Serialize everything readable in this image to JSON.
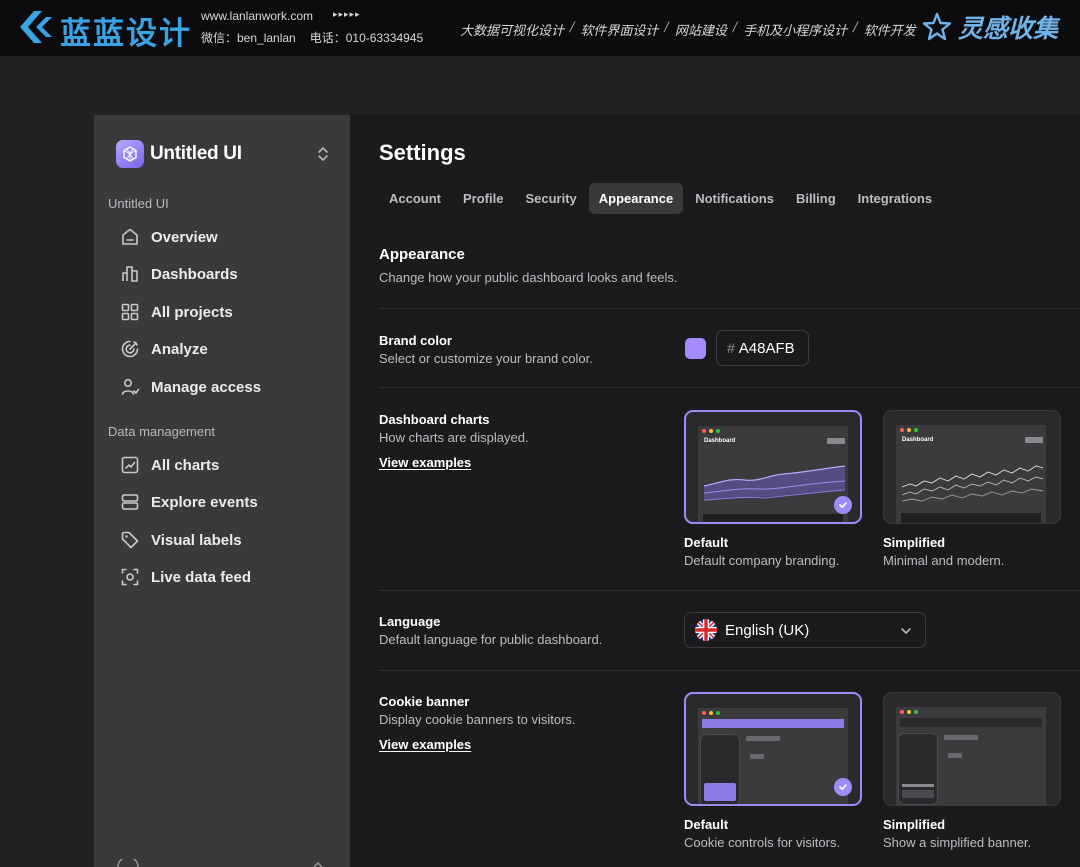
{
  "banner": {
    "brand_name": "蓝蓝设计",
    "url": "www.lanlanwork.com",
    "arrows": "▸▸▸▸▸",
    "wechat": "微信：ben_lanlan",
    "phone": "电话：010-63334945",
    "services": [
      "大数据可视化设计",
      "软件界面设计",
      "网站建设",
      "手机及小程序设计",
      "软件开发"
    ],
    "separator": "/",
    "collect_label": "灵感收集"
  },
  "workspace": {
    "name": "Untitled UI",
    "logo_color": "#A48AFB"
  },
  "sidebar": {
    "group1_title": "Untitled UI",
    "group1_items": [
      {
        "label": "Overview",
        "icon": "home-icon"
      },
      {
        "label": "Dashboards",
        "icon": "bar-chart-icon"
      },
      {
        "label": "All projects",
        "icon": "grid-icon"
      },
      {
        "label": "Analyze",
        "icon": "target-icon"
      },
      {
        "label": "Manage access",
        "icon": "users-icon"
      }
    ],
    "group2_title": "Data management",
    "group2_items": [
      {
        "label": "All charts",
        "icon": "line-chart-icon"
      },
      {
        "label": "Explore events",
        "icon": "server-icon"
      },
      {
        "label": "Visual labels",
        "icon": "tag-icon"
      },
      {
        "label": "Live data feed",
        "icon": "focus-icon"
      }
    ]
  },
  "settings": {
    "title": "Settings",
    "tabs": [
      "Account",
      "Profile",
      "Security",
      "Appearance",
      "Notifications",
      "Billing",
      "Integrations"
    ],
    "active_tab": "Appearance",
    "section_title": "Appearance",
    "section_desc": "Change how your public dashboard looks and feels.",
    "brand_color": {
      "label": "Brand color",
      "desc": "Select or customize your brand color.",
      "hash": "#",
      "value": "A48AFB",
      "swatch": "#A48AFB"
    },
    "dashboard_charts": {
      "label": "Dashboard charts",
      "desc": "How charts are displayed.",
      "link": "View examples",
      "mini_title": "Dashboard",
      "options": [
        {
          "name": "Default",
          "desc": "Default company branding.",
          "selected": true
        },
        {
          "name": "Simplified",
          "desc": "Minimal and modern.",
          "selected": false
        }
      ]
    },
    "language": {
      "label": "Language",
      "desc": "Default language for public dashboard.",
      "value": "English (UK)"
    },
    "cookie_banner": {
      "label": "Cookie banner",
      "desc": "Display cookie banners to visitors.",
      "link": "View examples",
      "options": [
        {
          "name": "Default",
          "desc": "Cookie controls for visitors.",
          "selected": true
        },
        {
          "name": "Simplified",
          "desc": "Show a simplified banner.",
          "selected": false
        }
      ]
    }
  }
}
